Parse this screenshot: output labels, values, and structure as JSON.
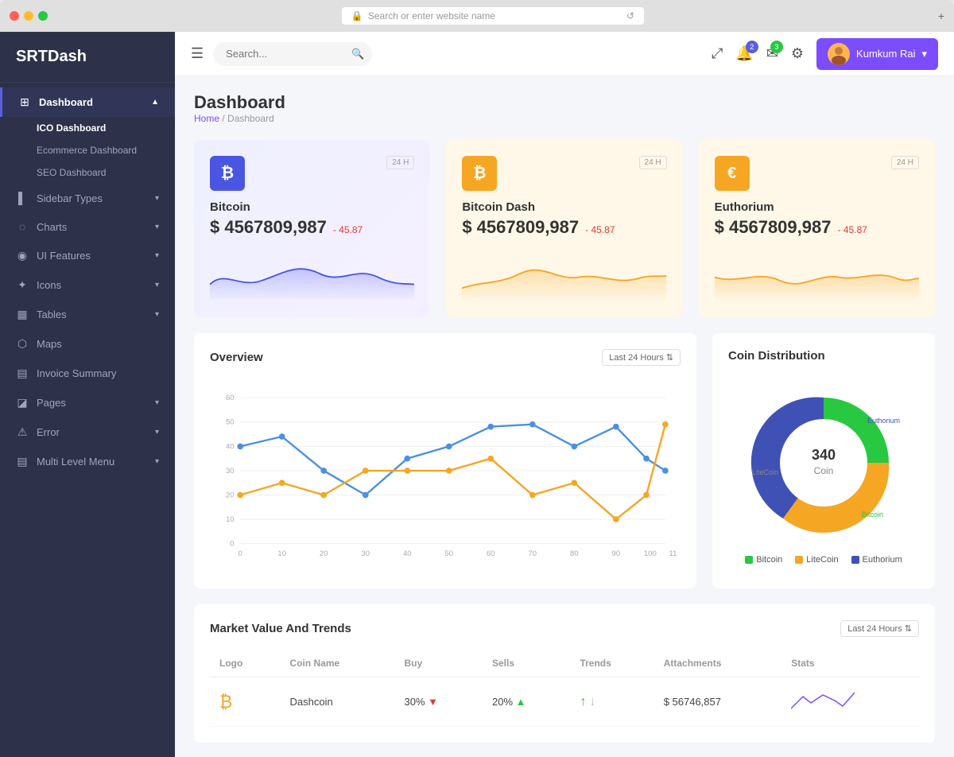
{
  "browser": {
    "address": "Search or enter website name"
  },
  "sidebar": {
    "logo": "SRTDash",
    "items": [
      {
        "id": "dashboard",
        "label": "Dashboard",
        "icon": "⊞",
        "arrow": "▲",
        "active": true,
        "sub": [
          {
            "label": "ICO Dashboard",
            "active": true
          },
          {
            "label": "Ecommerce Dashboard",
            "active": false
          },
          {
            "label": "SEO Dashboard",
            "active": false
          }
        ]
      },
      {
        "id": "sidebar-types",
        "label": "Sidebar Types",
        "icon": "▌",
        "arrow": "▾",
        "active": false
      },
      {
        "id": "charts",
        "label": "Charts",
        "icon": "◌",
        "arrow": "▾",
        "active": false
      },
      {
        "id": "ui-features",
        "label": "UI Features",
        "icon": "◉",
        "arrow": "▾",
        "active": false
      },
      {
        "id": "icons",
        "label": "Icons",
        "icon": "✦",
        "arrow": "▾",
        "active": false
      },
      {
        "id": "tables",
        "label": "Tables",
        "icon": "▦",
        "arrow": "▾",
        "active": false
      },
      {
        "id": "maps",
        "label": "Maps",
        "icon": "⬡",
        "arrow": "",
        "active": false
      },
      {
        "id": "invoice",
        "label": "Invoice Summary",
        "icon": "▤",
        "arrow": "",
        "active": false
      },
      {
        "id": "pages",
        "label": "Pages",
        "icon": "◪",
        "arrow": "▾",
        "active": false
      },
      {
        "id": "error",
        "label": "Error",
        "icon": "⚠",
        "arrow": "▾",
        "active": false
      },
      {
        "id": "multilevel",
        "label": "Multi Level Menu",
        "icon": "▤",
        "arrow": "▾",
        "active": false
      }
    ]
  },
  "topnav": {
    "search_placeholder": "Search...",
    "notifications_count": "2",
    "messages_count": "3",
    "user_name": "Kumkum Rai"
  },
  "page": {
    "title": "Dashboard",
    "breadcrumb_home": "Home",
    "breadcrumb_current": "Dashboard"
  },
  "stat_cards": [
    {
      "icon": "₿",
      "icon_class": "blue",
      "card_class": "blue-bg",
      "name": "Bitcoin",
      "badge": "24 H",
      "value": "$ 4567809,987",
      "change": "- 45.87"
    },
    {
      "icon": "₿",
      "icon_class": "yellow",
      "card_class": "yellow-bg",
      "name": "Bitcoin Dash",
      "badge": "24 H",
      "value": "$ 4567809,987",
      "change": "- 45.87"
    },
    {
      "icon": "€",
      "icon_class": "yellow",
      "card_class": "yellow-bg",
      "name": "Euthorium",
      "badge": "24 H",
      "value": "$ 4567809,987",
      "change": "- 45.87"
    }
  ],
  "overview": {
    "title": "Overview",
    "filter": "Last 24 Hours",
    "x_labels": [
      "0",
      "10",
      "20",
      "30",
      "40",
      "50",
      "60",
      "70",
      "80",
      "90",
      "100",
      "11"
    ],
    "y_labels": [
      "60",
      "50",
      "40",
      "30",
      "20",
      "10",
      "0"
    ]
  },
  "coin_distribution": {
    "title": "Coin Distribution",
    "center_label": "340 Coin",
    "segments": [
      {
        "label": "Bitcoin",
        "color": "#28c840",
        "percent": 25
      },
      {
        "label": "LiteCoin",
        "color": "#f5a623",
        "percent": 45
      },
      {
        "label": "Euthorium",
        "color": "#3f51b5",
        "percent": 30
      }
    ]
  },
  "market_table": {
    "title": "Market Value And Trends",
    "filter": "Last 24 Hours",
    "columns": [
      "Logo",
      "Coin Name",
      "Buy",
      "Sells",
      "Trends",
      "Attachments",
      "Stats"
    ],
    "rows": [
      {
        "logo": "₿",
        "coin_name": "Dashcoin",
        "buy": "30%",
        "buy_trend": "down",
        "sells": "20%",
        "sells_trend": "up",
        "trend_up": true,
        "attachments": "$ 56746,857",
        "stats": "sparkline"
      }
    ]
  }
}
